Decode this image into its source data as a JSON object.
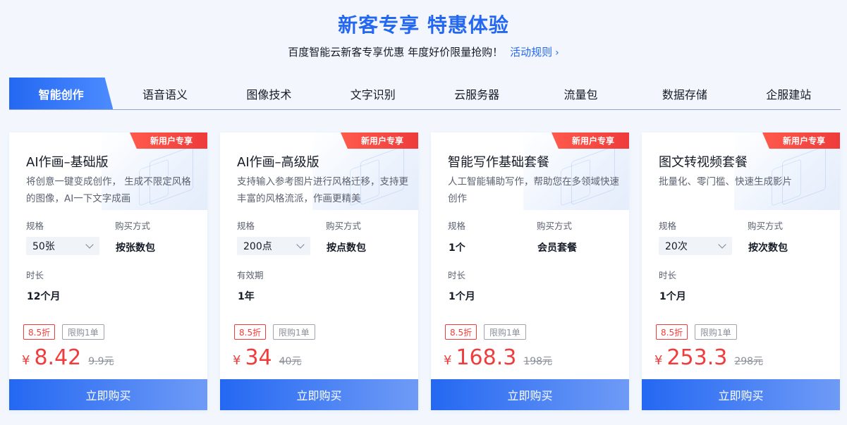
{
  "hero": {
    "title": "新客专享 特惠体验",
    "subtitle": "百度智能云新客专享优惠 年度好价限量抢购！",
    "rules_link": "活动规则"
  },
  "tabs": [
    "智能创作",
    "语音语义",
    "图像技术",
    "文字识别",
    "云服务器",
    "流量包",
    "数据存储",
    "企服建站"
  ],
  "active_tab": "智能创作",
  "colors": {
    "brand": "#2468f2",
    "price": "#f03c3c",
    "ribbon": "#ee3b3b"
  },
  "cards": [
    {
      "ribbon": "新用户专享",
      "title": "AI作画–基础版",
      "desc": "将创意一键变成创作， 生成不限定风格的图像，AI一下文字成画",
      "spec_label": "规格",
      "spec_value": "50张",
      "purchase_label": "购买方式",
      "purchase_value": "按张数包",
      "duration_label": "时长",
      "duration_value": "12个月",
      "discount": "8.5折",
      "limit": "限购1单",
      "currency": "¥",
      "price": "8.42",
      "orig_price": "9.9元",
      "buy_label": "立即购买"
    },
    {
      "ribbon": "新用户专享",
      "title": "AI作画–高级版",
      "desc": "支持输入参考图片进行风格迁移，支持更丰富的风格流派，作画更精美",
      "spec_label": "规格",
      "spec_value": "200点",
      "purchase_label": "购买方式",
      "purchase_value": "按点数包",
      "duration_label": "有效期",
      "duration_value": "1年",
      "discount": "8.5折",
      "limit": "限购1单",
      "currency": "¥",
      "price": "34",
      "orig_price": "40元",
      "buy_label": "立即购买"
    },
    {
      "ribbon": "新用户专享",
      "title": "智能写作基础套餐",
      "desc": "人工智能辅助写作，帮助您在多领域快速创作",
      "spec_label": "规格",
      "spec_value": "1个",
      "purchase_label": "购买方式",
      "purchase_value": "会员套餐",
      "duration_label": "时长",
      "duration_value": "1个月",
      "discount": "8.5折",
      "limit": "限购1单",
      "currency": "¥",
      "price": "168.3",
      "orig_price": "198元",
      "buy_label": "立即购买"
    },
    {
      "ribbon": "新用户专享",
      "title": "图文转视频套餐",
      "desc": "批量化、零门槛、快速生成影片",
      "spec_label": "规格",
      "spec_value": "20次",
      "purchase_label": "购买方式",
      "purchase_value": "按次数包",
      "duration_label": "时长",
      "duration_value": "1个月",
      "discount": "8.5折",
      "limit": "限购1单",
      "currency": "¥",
      "price": "253.3",
      "orig_price": "298元",
      "buy_label": "立即购买"
    }
  ]
}
